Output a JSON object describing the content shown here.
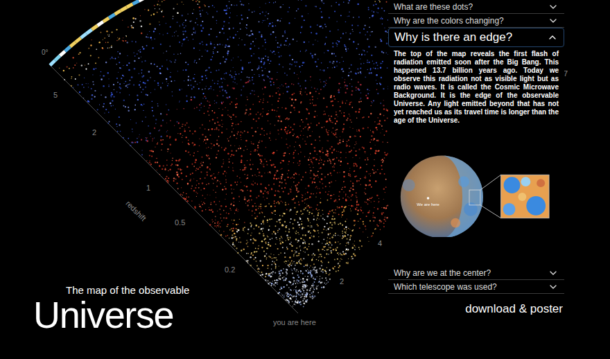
{
  "map": {
    "angle_label": "0°",
    "left_axis": [
      "5",
      "2",
      "1",
      "0.5",
      "0.2"
    ],
    "axis_title": "redshift",
    "right_axis": [
      "2",
      "4"
    ],
    "edge_label": "7",
    "marker": "you are here"
  },
  "title": {
    "subtitle": "The map of the observable",
    "main": "Universe"
  },
  "faq": [
    {
      "question": "What are these dots?",
      "expanded": false
    },
    {
      "question": "Why are the colors changing?",
      "expanded": false
    },
    {
      "question": "Why is there an edge?",
      "expanded": true,
      "answer": "The top of the map reveals the first flash of radiation emitted soon after the Big Bang. This happened 13.7 billion years ago. Today we observe this radiation not as visible light but as radio waves. It is called the Cosmic Microwave Background. It is the edge of the observable Universe. Any light emitted beyond that has not yet reached us as its travel time is longer than the age of the Universe.",
      "figure": {
        "label": "We are here"
      }
    },
    {
      "question": "Why are we at the center?",
      "expanded": false
    },
    {
      "question": "Which telescope was used?",
      "expanded": false
    }
  ],
  "download": "download & poster"
}
